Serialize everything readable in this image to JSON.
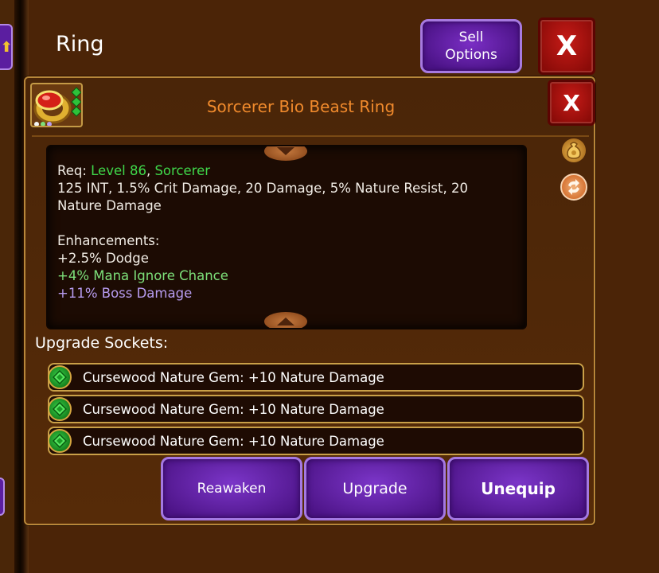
{
  "page": {
    "title": "Ring",
    "sell_options_line1": "Sell",
    "sell_options_line2": "Options",
    "close_label": "X"
  },
  "dialog": {
    "close_label": "X",
    "item_name": "Sorcerer Bio Beast Ring",
    "item_name_color": "#f08a2c",
    "requirements": {
      "label": "Req: ",
      "level": "Level 86",
      "separator": ", ",
      "class": "Sorcerer"
    },
    "stats_line": "125 INT, 1.5% Crit Damage, 20 Damage, 5% Nature Resist, 20 Nature Damage",
    "enhancements_title": "Enhancements:",
    "enhancements": [
      {
        "text": "+2.5% Dodge",
        "color": "#f2ede6"
      },
      {
        "text": "+4% Mana Ignore Chance",
        "color": "#7de07a"
      },
      {
        "text": "+11% Boss Damage",
        "color": "#b79cf0"
      }
    ],
    "upgrade_sockets_label": "Upgrade Sockets:",
    "sockets": [
      {
        "text": "Cursewood Nature Gem: +10 Nature Damage",
        "gem": "green-gem-icon"
      },
      {
        "text": "Cursewood Nature Gem: +10 Nature Damage",
        "gem": "green-gem-icon"
      },
      {
        "text": "Cursewood Nature Gem: +10 Nature Damage",
        "gem": "green-gem-icon"
      }
    ],
    "buttons": {
      "reawaken": "Reawaken",
      "upgrade": "Upgrade",
      "unequip": "Unequip"
    }
  },
  "colors": {
    "button_purple": "#5b1ea0",
    "close_red": "#c61b17",
    "requirement_green": "#3fd84a"
  }
}
